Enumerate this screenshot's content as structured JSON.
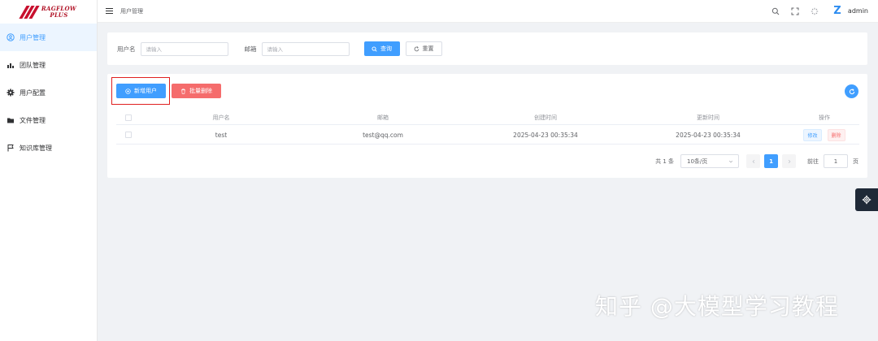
{
  "app": {
    "logo_line1": "RAGFLOW",
    "logo_line2": "PLUS",
    "brand_color": "#c8102e",
    "accent_color": "#409eff",
    "danger_color": "#f56c6c"
  },
  "sidebar": {
    "items": [
      {
        "label": "用户管理",
        "icon": "user-circle-icon",
        "active": true
      },
      {
        "label": "团队管理",
        "icon": "bar-chart-icon",
        "active": false
      },
      {
        "label": "用户配置",
        "icon": "gear-icon",
        "active": false
      },
      {
        "label": "文件管理",
        "icon": "folder-icon",
        "active": false
      },
      {
        "label": "知识库管理",
        "icon": "flag-icon",
        "active": false
      }
    ]
  },
  "header": {
    "breadcrumb": "用户管理",
    "user_name": "admin",
    "icons": [
      "search-icon",
      "fullscreen-icon",
      "theme-icon",
      "avatar-icon"
    ]
  },
  "search": {
    "username_label": "用户名",
    "username_placeholder": "请输入",
    "email_label": "邮箱",
    "email_placeholder": "请输入",
    "query_button": "查询",
    "reset_button": "重置"
  },
  "toolbar": {
    "add_button": "新增用户",
    "batch_delete_button": "批量删除"
  },
  "table": {
    "columns": [
      "用户名",
      "邮箱",
      "创建时间",
      "更新时间",
      "操作"
    ],
    "rows": [
      {
        "username": "test",
        "email": "test@qq.com",
        "created": "2025-04-23 00:35:34",
        "updated": "2025-04-23 00:35:34",
        "edit": "修改",
        "delete": "删除"
      }
    ]
  },
  "pagination": {
    "total_text": "共 1 条",
    "page_size": "10条/页",
    "current_page": "1",
    "goto_label": "前往",
    "goto_value": "1",
    "page_suffix": "页"
  },
  "watermark": "知乎 @大模型学习教程"
}
